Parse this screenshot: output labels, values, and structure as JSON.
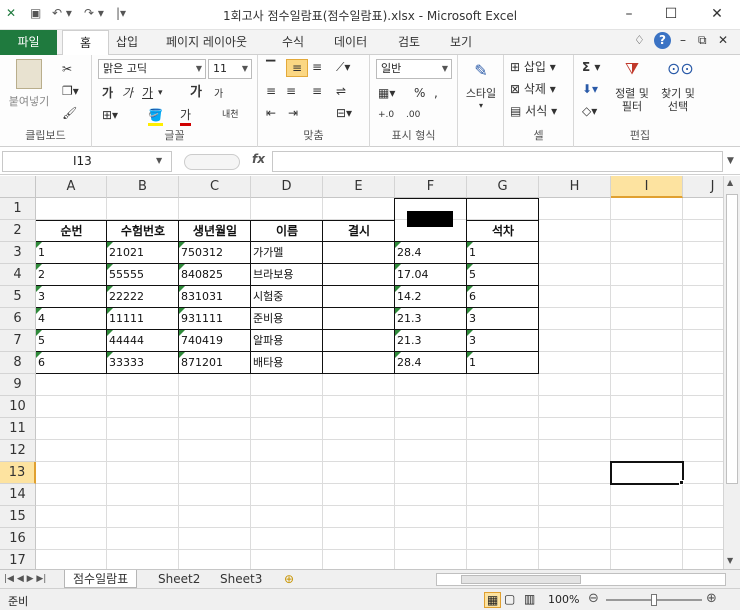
{
  "window": {
    "title": "1회고사 점수일람표(점수일람표).xlsx  -  Microsoft Excel"
  },
  "ribbon_tabs": [
    "파일",
    "홈",
    "삽입",
    "페이지 레이아웃",
    "수식",
    "데이터",
    "검토",
    "보기"
  ],
  "ribbon": {
    "clipboard": {
      "paste": "붙여넣기",
      "label": "클립보드"
    },
    "font": {
      "name": "맑은 고딕",
      "size": "11",
      "label": "글꼴",
      "bold": "가",
      "italic": "가",
      "underline": "가",
      "grow": "가",
      "shrink": "가",
      "phonetic": "내천"
    },
    "align": {
      "label": "맞춤"
    },
    "number": {
      "format": "일반",
      "label": "표시 형식"
    },
    "styles": {
      "label": "스타일"
    },
    "cells": {
      "insert": "삽입",
      "delete": "삭제",
      "format": "서식",
      "label": "셀"
    },
    "editing": {
      "sort": "정렬 및 필터",
      "find": "찾기 및 선택",
      "label": "편집"
    }
  },
  "formula_bar": {
    "name_box": "I13",
    "fx": "fx",
    "value": ""
  },
  "columns": [
    "A",
    "B",
    "C",
    "D",
    "E",
    "F",
    "G",
    "H",
    "I",
    "J"
  ],
  "rows": [
    "1",
    "2",
    "3",
    "4",
    "5",
    "6",
    "7",
    "8",
    "9",
    "10",
    "11",
    "12",
    "13",
    "14",
    "15",
    "16",
    "17"
  ],
  "table": {
    "headers": [
      "순번",
      "수험번호",
      "생년월일",
      "이름",
      "결시",
      "",
      "석차"
    ],
    "rows": [
      [
        "1",
        "21021",
        "750312",
        "가가멜",
        "",
        "28.4",
        "1"
      ],
      [
        "2",
        "55555",
        "840825",
        "브라보용",
        "",
        "17.04",
        "5"
      ],
      [
        "3",
        "22222",
        "831031",
        "시험중",
        "",
        "14.2",
        "6"
      ],
      [
        "4",
        "11111",
        "931111",
        "준비용",
        "",
        "21.3",
        "3"
      ],
      [
        "5",
        "44444",
        "740419",
        "알파용",
        "",
        "21.3",
        "3"
      ],
      [
        "6",
        "33333",
        "871201",
        "배타용",
        "",
        "28.4",
        "1"
      ]
    ]
  },
  "sheets": [
    "점수일람표",
    "Sheet2",
    "Sheet3"
  ],
  "status": {
    "ready": "준비",
    "zoom": "100%"
  }
}
